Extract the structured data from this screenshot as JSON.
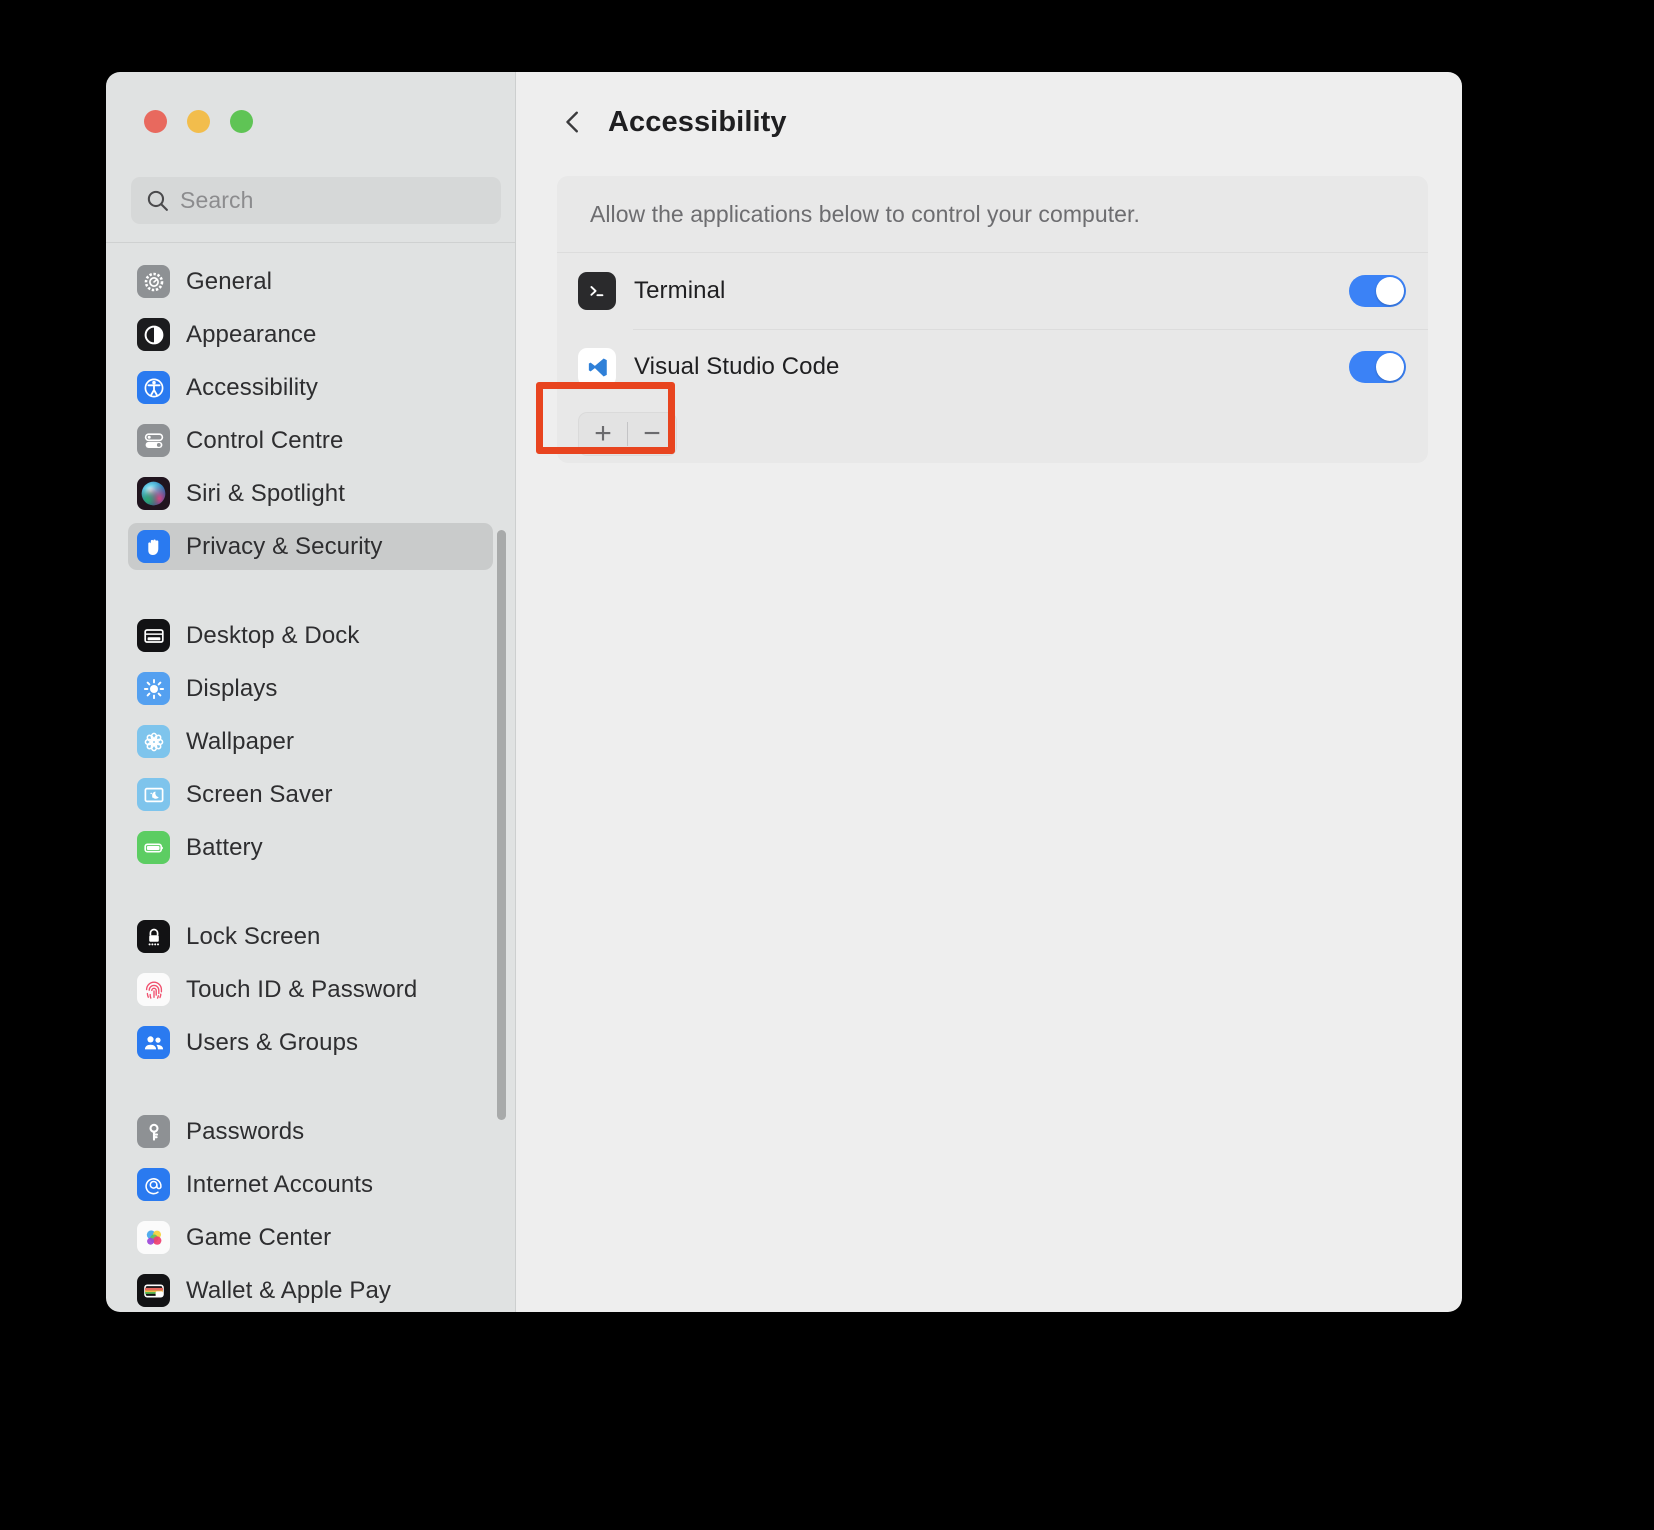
{
  "window": {
    "traffic_lights": [
      {
        "name": "close",
        "color": "#e8695e"
      },
      {
        "name": "minimize",
        "color": "#f2bd4c"
      },
      {
        "name": "zoom",
        "color": "#5fc455"
      }
    ]
  },
  "sidebar": {
    "search": {
      "placeholder": "Search",
      "value": "",
      "icon": "search-icon"
    },
    "groups": [
      {
        "items": [
          {
            "label": "General",
            "icon": "gear-icon",
            "selected": false
          },
          {
            "label": "Appearance",
            "icon": "appearance-icon",
            "selected": false
          },
          {
            "label": "Accessibility",
            "icon": "accessibility-icon",
            "selected": false
          },
          {
            "label": "Control Centre",
            "icon": "control-centre-icon",
            "selected": false
          },
          {
            "label": "Siri & Spotlight",
            "icon": "siri-icon",
            "selected": false
          },
          {
            "label": "Privacy & Security",
            "icon": "privacy-hand-icon",
            "selected": true
          }
        ]
      },
      {
        "items": [
          {
            "label": "Desktop & Dock",
            "icon": "desktop-dock-icon",
            "selected": false
          },
          {
            "label": "Displays",
            "icon": "displays-icon",
            "selected": false
          },
          {
            "label": "Wallpaper",
            "icon": "wallpaper-icon",
            "selected": false
          },
          {
            "label": "Screen Saver",
            "icon": "screen-saver-icon",
            "selected": false
          },
          {
            "label": "Battery",
            "icon": "battery-icon",
            "selected": false
          }
        ]
      },
      {
        "items": [
          {
            "label": "Lock Screen",
            "icon": "lock-screen-icon",
            "selected": false
          },
          {
            "label": "Touch ID & Password",
            "icon": "touch-id-icon",
            "selected": false
          },
          {
            "label": "Users & Groups",
            "icon": "users-groups-icon",
            "selected": false
          }
        ]
      },
      {
        "items": [
          {
            "label": "Passwords",
            "icon": "passwords-key-icon",
            "selected": false
          },
          {
            "label": "Internet Accounts",
            "icon": "internet-accounts-icon",
            "selected": false
          },
          {
            "label": "Game Center",
            "icon": "game-center-icon",
            "selected": false
          },
          {
            "label": "Wallet & Apple Pay",
            "icon": "wallet-icon",
            "selected": false
          }
        ]
      }
    ]
  },
  "main": {
    "back_label": "‹",
    "title": "Accessibility",
    "note": "Allow the applications below to control your computer.",
    "apps": [
      {
        "name": "Terminal",
        "icon": "terminal-icon",
        "enabled": true
      },
      {
        "name": "Visual Studio Code",
        "icon": "vscode-icon",
        "enabled": true
      }
    ],
    "footer": {
      "add_label": "+",
      "remove_label": "−"
    }
  },
  "colors": {
    "toggle_on": "#3b82f6",
    "selection": "#c9cbcb",
    "annotation": "#e8441f",
    "sidebar_bg": "#e0e2e2",
    "main_bg": "#eeeeee"
  }
}
